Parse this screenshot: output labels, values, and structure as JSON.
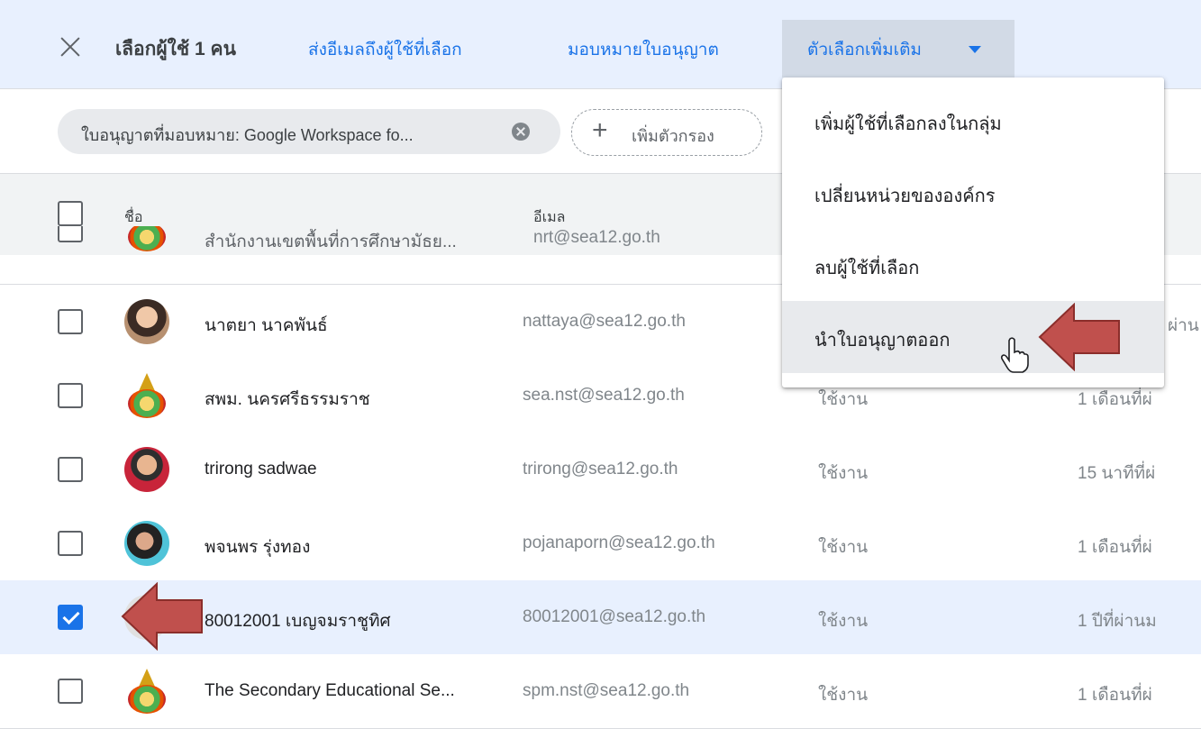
{
  "topbar": {
    "selected_label": "เลือกผู้ใช้ 1 คน",
    "email_selected": "ส่งอีเมลถึงผู้ใช้ที่เลือก",
    "assign_license": "มอบหมายใบอนุญาต",
    "more_options": "ตัวเลือกเพิ่มเติม"
  },
  "filter": {
    "chip_label": "ใบอนุญาตที่มอบหมาย: Google Workspace fo...",
    "add_filter": "เพิ่มตัวกรอง"
  },
  "table": {
    "columns": {
      "name": "ชื่อ",
      "email": "อีเมล"
    },
    "partial_row": {
      "name": "สำนักงานเขตพื้นที่การศึกษามัธย...",
      "email": "nrt@sea12.go.th"
    },
    "rows": [
      {
        "name": "นาตยา นาคพันธ์",
        "email": "nattaya@sea12.go.th",
        "status": "",
        "last": "ผ่าน",
        "avatar": "photo-avatar",
        "checked": false
      },
      {
        "name": "สพม. นครศรีธรรมราช",
        "email": "sea.nst@sea12.go.th",
        "status": "ใช้งาน",
        "last": "1 เดือนที่ผ่",
        "avatar": "emblem-avatar",
        "checked": false
      },
      {
        "name": "trirong sadwae",
        "email": "trirong@sea12.go.th",
        "status": "ใช้งาน",
        "last": "15 นาทีที่ผ่",
        "avatar": "photo-avatar",
        "checked": false
      },
      {
        "name": "พจนพร รุ่งทอง",
        "email": "pojanaporn@sea12.go.th",
        "status": "ใช้งาน",
        "last": "1 เดือนที่ผ่",
        "avatar": "photo-avatar",
        "checked": false
      },
      {
        "name": "80012001 เบญจมราชูทิศ",
        "email": "80012001@sea12.go.th",
        "status": "ใช้งาน",
        "last": "1 ปีที่ผ่านม",
        "avatar": "blank-avatar",
        "checked": true
      },
      {
        "name": "The Secondary Educational Se...",
        "email": "spm.nst@sea12.go.th",
        "status": "ใช้งาน",
        "last": "1 เดือนที่ผ่",
        "avatar": "emblem-avatar",
        "checked": false
      }
    ]
  },
  "menu": {
    "items": [
      "เพิ่มผู้ใช้ที่เลือกลงในกลุ่ม",
      "เปลี่ยนหน่วยขององค์กร",
      "ลบผู้ใช้ที่เลือก",
      "นำใบอนุญาตออก"
    ],
    "hovered_index": 3
  },
  "colors": {
    "accent": "#1a73e8",
    "selection_bg": "#e8f0fe",
    "annotation_arrow": "#c0504d"
  },
  "icons": [
    "close-icon",
    "chip-remove-icon",
    "plus-icon",
    "caret-down-icon",
    "hand-pointer-icon"
  ]
}
